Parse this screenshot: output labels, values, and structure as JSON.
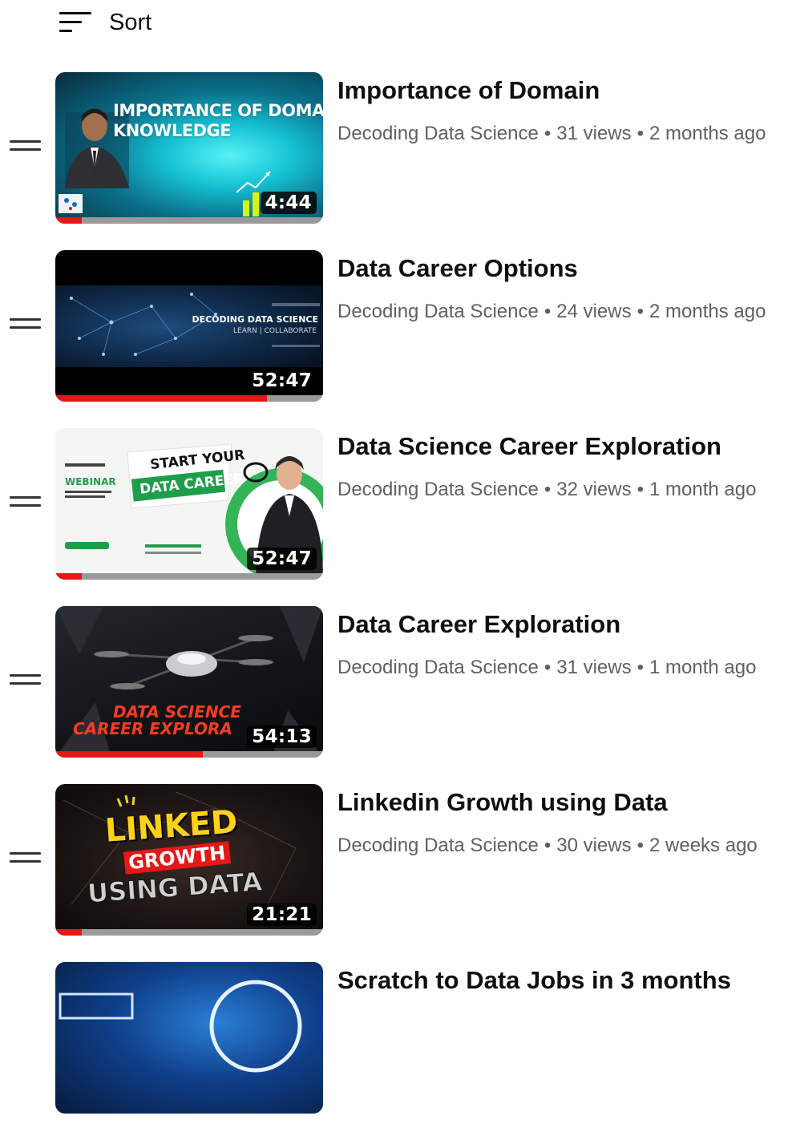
{
  "sort": {
    "label": "Sort",
    "icon": "sort-icon"
  },
  "colors": {
    "progress": "#e51717",
    "track": "#9a9a9a",
    "meta_text": "#606060",
    "title_text": "#0f0f0f"
  },
  "videos": [
    {
      "title": "Importance of Domain",
      "channel": "Decoding Data Science",
      "views": "31 views",
      "age": "2 months ago",
      "duration": "4:44",
      "watched_fraction": 0.1,
      "thumb_lines": [
        "IMPORTANCE OF DOMAIN",
        "KNOWLEDGE"
      ]
    },
    {
      "title": "Data Career Options",
      "channel": "Decoding Data Science",
      "views": "24 views",
      "age": "2 months ago",
      "duration": "52:47",
      "watched_fraction": 0.79,
      "thumb_lines": [
        "DECODING DATA SCIENCE",
        "LEARN | COLLABORATE"
      ]
    },
    {
      "title": "Data Science Career Exploration",
      "channel": "Decoding Data Science",
      "views": "32 views",
      "age": "1 month ago",
      "duration": "52:47",
      "watched_fraction": 0.1,
      "thumb_lines": [
        "START YOUR",
        "DATA CAREER",
        "WEBINAR"
      ]
    },
    {
      "title": "Data Career Exploration",
      "channel": "Decoding Data Science",
      "views": "31 views",
      "age": "1 month ago",
      "duration": "54:13",
      "watched_fraction": 0.55,
      "thumb_lines": [
        "DATA SCIENCE",
        "CAREER EXPLORA"
      ]
    },
    {
      "title": "Linkedin Growth using Data",
      "channel": "Decoding Data Science",
      "views": "30 views",
      "age": "2 weeks ago",
      "duration": "21:21",
      "watched_fraction": 0.1,
      "thumb_lines": [
        "LINKED",
        "GROWTH",
        "USING DATA"
      ]
    },
    {
      "title": "Scratch to Data Jobs in 3 months",
      "channel": "",
      "views": "",
      "age": "",
      "duration": "",
      "watched_fraction": 0
    }
  ]
}
